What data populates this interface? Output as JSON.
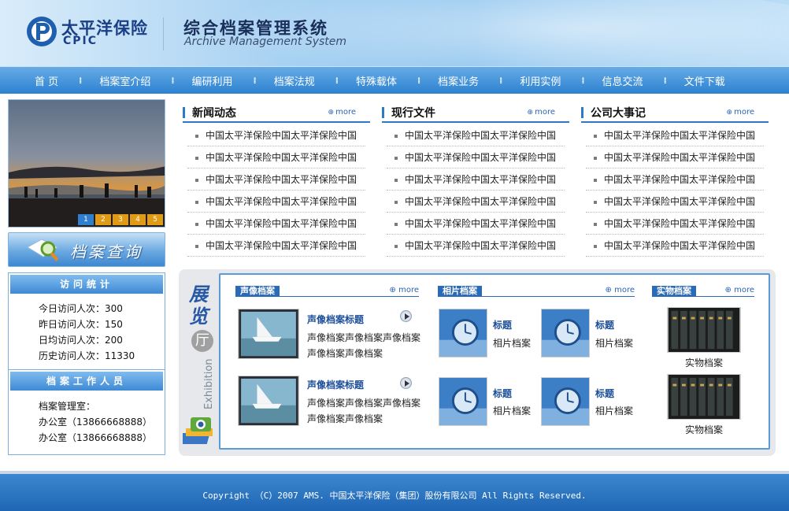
{
  "header": {
    "logo_cn": "太平洋保险",
    "logo_en": "CPIC",
    "system_cn": "综合档案管理系统",
    "system_en": "Archive Management System"
  },
  "nav": [
    "首 页",
    "档案室介绍",
    "编研利用",
    "档案法规",
    "特殊载体",
    "档案业务",
    "利用实例",
    "信息交流",
    "文件下载"
  ],
  "banner": {
    "pages": [
      "1",
      "2",
      "3",
      "4",
      "5"
    ],
    "active": 0
  },
  "search_button": "档案查询",
  "visit_stats": {
    "title": "访问统计",
    "lines": [
      "今日访问人次：300",
      "昨日访问人次：150",
      "日均访问人次：200",
      "历史访问人次：11330"
    ]
  },
  "staff": {
    "title": "档案工作人员",
    "lines": [
      "档案管理室：",
      "办公室（13866668888）",
      "办公室（13866668888）"
    ]
  },
  "columns": [
    {
      "title": "新闻动态",
      "more": "more",
      "items": [
        "中国太平洋保险中国太平洋保险中国",
        "中国太平洋保险中国太平洋保险中国",
        "中国太平洋保险中国太平洋保险中国",
        "中国太平洋保险中国太平洋保险中国",
        "中国太平洋保险中国太平洋保险中国",
        "中国太平洋保险中国太平洋保险中国"
      ]
    },
    {
      "title": "现行文件",
      "more": "more",
      "items": [
        "中国太平洋保险中国太平洋保险中国",
        "中国太平洋保险中国太平洋保险中国",
        "中国太平洋保险中国太平洋保险中国",
        "中国太平洋保险中国太平洋保险中国",
        "中国太平洋保险中国太平洋保险中国",
        "中国太平洋保险中国太平洋保险中国"
      ]
    },
    {
      "title": "公司大事记",
      "more": "more",
      "items": [
        "中国太平洋保险中国太平洋保险中国",
        "中国太平洋保险中国太平洋保险中国",
        "中国太平洋保险中国太平洋保险中国",
        "中国太平洋保险中国太平洋保险中国",
        "中国太平洋保险中国太平洋保险中国",
        "中国太平洋保险中国太平洋保险中国"
      ]
    }
  ],
  "exhibition": {
    "title": "展览",
    "title_char": "厅",
    "subtitle_en": "Exhibition",
    "audio": {
      "tag": "声像档案",
      "more": "more",
      "items": [
        {
          "title": "声像档案标题",
          "desc": "声像档案声像档案声像档案声像档案声像档案"
        },
        {
          "title": "声像档案标题",
          "desc": "声像档案声像档案声像档案声像档案声像档案"
        }
      ]
    },
    "photo": {
      "tag": "相片档案",
      "more": "more",
      "items": [
        {
          "title": "标题",
          "desc": "相片档案"
        },
        {
          "title": "标题",
          "desc": "相片档案"
        },
        {
          "title": "标题",
          "desc": "相片档案"
        },
        {
          "title": "标题",
          "desc": "相片档案"
        }
      ]
    },
    "object": {
      "tag": "实物档案",
      "more": "more",
      "items": [
        {
          "caption": "实物档案"
        },
        {
          "caption": "实物档案"
        }
      ]
    }
  },
  "footer": "Copyright （C）2007 AMS. 中国太平洋保险（集团）股份有限公司  All Rights Reserved."
}
